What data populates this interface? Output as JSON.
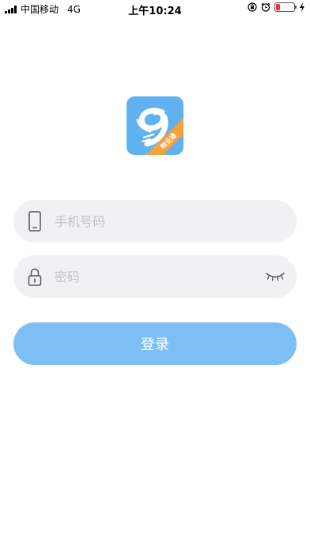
{
  "status_bar": {
    "carrier": "中国移动",
    "network": "4G",
    "time": "上午10:24"
  },
  "logo": {
    "badge_text": "物业通",
    "icon": "app-logo-icon"
  },
  "form": {
    "phone_placeholder": "手机号码",
    "password_placeholder": "密码",
    "login_label": "登录"
  },
  "colors": {
    "logo_bg": "#5fb1f0",
    "badge": "#f7a23a",
    "field_bg": "#f1f1f4",
    "button_bg": "#7dbff4",
    "battery_low": "#ff2d2d"
  }
}
